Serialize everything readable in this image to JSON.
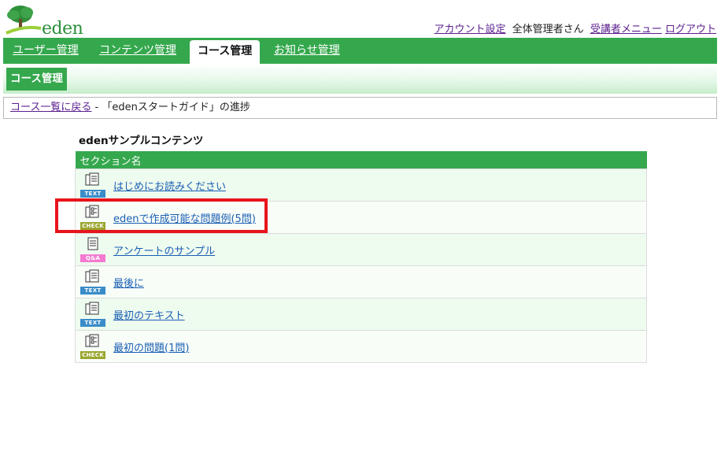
{
  "logo": {
    "text": "eden",
    "icon": "tree-logo-icon"
  },
  "topnav": {
    "account_settings": "アカウント設定",
    "user_label": "全体管理者さん",
    "learner_menu": "受講者メニュー",
    "logout": "ログアウト"
  },
  "mainnav": {
    "tabs": [
      {
        "label": "ユーザー管理"
      },
      {
        "label": "コンテンツ管理"
      },
      {
        "label": "コース管理",
        "active": true
      },
      {
        "label": "お知らせ管理"
      }
    ]
  },
  "subnav": {
    "active": "コース管理"
  },
  "breadcrumb": {
    "back_link": "コース一覧に戻る",
    "separator": "-",
    "current": "「edenスタートガイド」の進捗"
  },
  "content": {
    "title": "edenサンプルコンテンツ",
    "column_header": "セクション名",
    "sections": [
      {
        "label": "はじめにお読みください",
        "badge": "TEXT",
        "icon": "text-document-icon"
      },
      {
        "label": "edenで作成可能な問題例(5問)",
        "badge": "CHECK",
        "icon": "check-document-icon",
        "highlighted": true
      },
      {
        "label": "アンケートのサンプル",
        "badge": "Q&A",
        "icon": "qa-document-icon"
      },
      {
        "label": "最後に",
        "badge": "TEXT",
        "icon": "text-document-icon"
      },
      {
        "label": "最初のテキスト",
        "badge": "TEXT",
        "icon": "text-document-icon"
      },
      {
        "label": "最初の問題(1問)",
        "badge": "CHECK",
        "icon": "check-document-icon"
      }
    ]
  },
  "colors": {
    "brand_green": "#35a84d",
    "highlight_red": "#e8141b",
    "link_blue": "#1a5fb4",
    "visited_purple": "#5a1f8f"
  }
}
